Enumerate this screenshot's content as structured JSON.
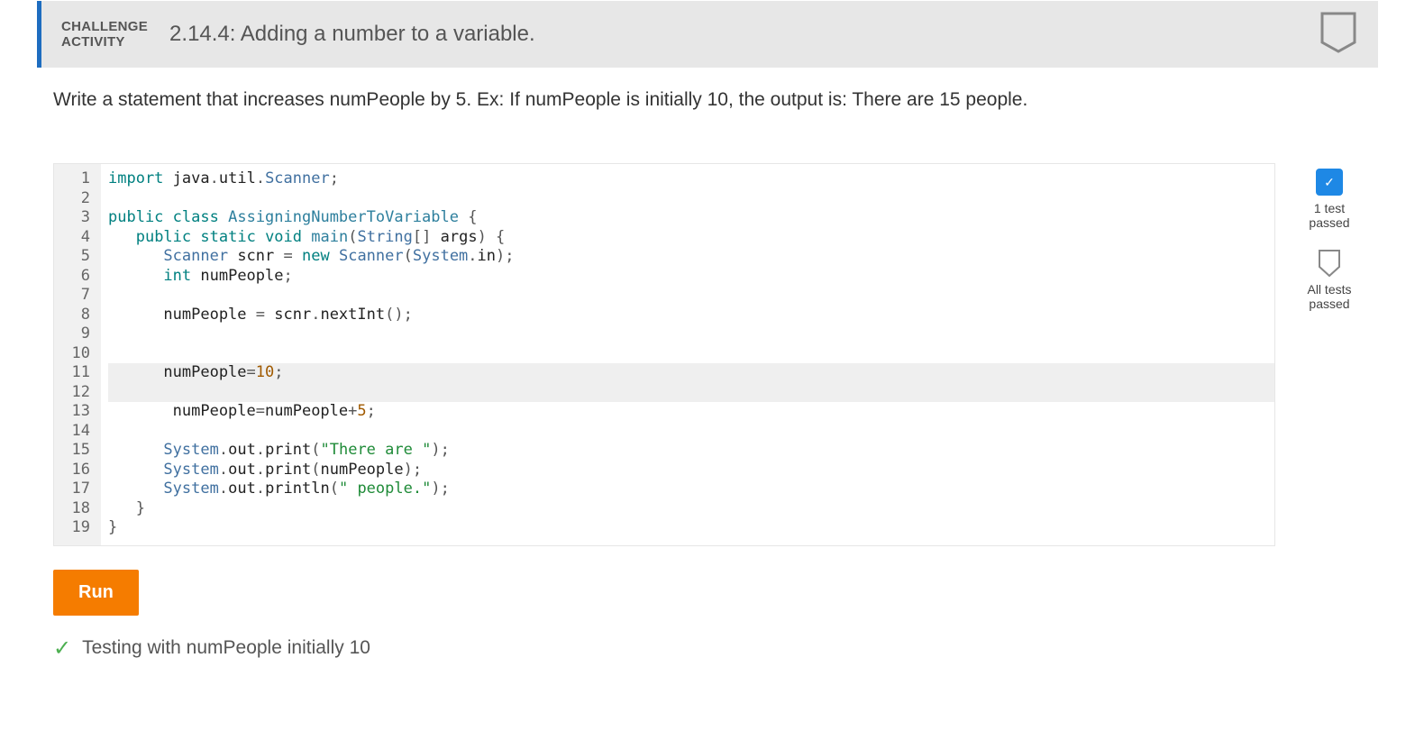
{
  "header": {
    "kicker_line1": "CHALLENGE",
    "kicker_line2": "ACTIVITY",
    "title": "2.14.4: Adding a number to a variable."
  },
  "prompt": "Write a statement that increases numPeople by 5. Ex: If numPeople is initially 10, the output is: There are 15 people.",
  "code": {
    "line_count": 19,
    "lines": [
      {
        "n": 1,
        "t": [
          [
            "kw",
            "import"
          ],
          [
            "",
            " java"
          ],
          [
            "pn",
            "."
          ],
          [
            "",
            "util"
          ],
          [
            "pn",
            "."
          ],
          [
            "ty",
            "Scanner"
          ],
          [
            "pn",
            ";"
          ]
        ]
      },
      {
        "n": 2,
        "t": [
          [
            "",
            ""
          ]
        ]
      },
      {
        "n": 3,
        "t": [
          [
            "kw",
            "public"
          ],
          [
            "",
            " "
          ],
          [
            "kw",
            "class"
          ],
          [
            "",
            " "
          ],
          [
            "nm",
            "AssigningNumberToVariable"
          ],
          [
            "",
            " "
          ],
          [
            "pn",
            "{"
          ]
        ]
      },
      {
        "n": 4,
        "t": [
          [
            "",
            "   "
          ],
          [
            "kw",
            "public"
          ],
          [
            "",
            " "
          ],
          [
            "kw",
            "static"
          ],
          [
            "",
            " "
          ],
          [
            "kw",
            "void"
          ],
          [
            "",
            " "
          ],
          [
            "nm",
            "main"
          ],
          [
            "pn",
            "("
          ],
          [
            "ty",
            "String"
          ],
          [
            "pn",
            "[]"
          ],
          [
            "",
            " args"
          ],
          [
            "pn",
            ") {"
          ]
        ]
      },
      {
        "n": 5,
        "t": [
          [
            "",
            "      "
          ],
          [
            "ty",
            "Scanner"
          ],
          [
            "",
            " scnr "
          ],
          [
            "pn",
            "="
          ],
          [
            "",
            " "
          ],
          [
            "kw",
            "new"
          ],
          [
            "",
            " "
          ],
          [
            "ty",
            "Scanner"
          ],
          [
            "pn",
            "("
          ],
          [
            "ty",
            "System"
          ],
          [
            "pn",
            "."
          ],
          [
            "",
            "in"
          ],
          [
            "pn",
            ");"
          ]
        ]
      },
      {
        "n": 6,
        "t": [
          [
            "",
            "      "
          ],
          [
            "kw",
            "int"
          ],
          [
            "",
            " numPeople"
          ],
          [
            "pn",
            ";"
          ]
        ]
      },
      {
        "n": 7,
        "t": [
          [
            "",
            ""
          ]
        ]
      },
      {
        "n": 8,
        "t": [
          [
            "",
            "      numPeople "
          ],
          [
            "pn",
            "="
          ],
          [
            "",
            " scnr"
          ],
          [
            "pn",
            "."
          ],
          [
            "",
            "nextInt"
          ],
          [
            "pn",
            "();"
          ]
        ]
      },
      {
        "n": 9,
        "t": [
          [
            "",
            ""
          ]
        ]
      },
      {
        "n": 10,
        "t": [
          [
            "",
            ""
          ]
        ]
      },
      {
        "n": 11,
        "hl": true,
        "t": [
          [
            "",
            "      numPeople"
          ],
          [
            "pn",
            "="
          ],
          [
            "nu",
            "10"
          ],
          [
            "pn",
            ";"
          ]
        ]
      },
      {
        "n": 12,
        "hl": true,
        "t": [
          [
            "",
            "      "
          ]
        ]
      },
      {
        "n": 13,
        "t": [
          [
            "",
            "       numPeople"
          ],
          [
            "pn",
            "="
          ],
          [
            "",
            "numPeople"
          ],
          [
            "pn",
            "+"
          ],
          [
            "nu",
            "5"
          ],
          [
            "pn",
            ";"
          ]
        ]
      },
      {
        "n": 14,
        "t": [
          [
            "",
            ""
          ]
        ]
      },
      {
        "n": 15,
        "t": [
          [
            "",
            "      "
          ],
          [
            "ty",
            "System"
          ],
          [
            "pn",
            "."
          ],
          [
            "",
            "out"
          ],
          [
            "pn",
            "."
          ],
          [
            "",
            "print"
          ],
          [
            "pn",
            "("
          ],
          [
            "st",
            "\"There are \""
          ],
          [
            "pn",
            ");"
          ]
        ]
      },
      {
        "n": 16,
        "t": [
          [
            "",
            "      "
          ],
          [
            "ty",
            "System"
          ],
          [
            "pn",
            "."
          ],
          [
            "",
            "out"
          ],
          [
            "pn",
            "."
          ],
          [
            "",
            "print"
          ],
          [
            "pn",
            "("
          ],
          [
            "",
            "numPeople"
          ],
          [
            "pn",
            ");"
          ]
        ]
      },
      {
        "n": 17,
        "t": [
          [
            "",
            "      "
          ],
          [
            "ty",
            "System"
          ],
          [
            "pn",
            "."
          ],
          [
            "",
            "out"
          ],
          [
            "pn",
            "."
          ],
          [
            "",
            "println"
          ],
          [
            "pn",
            "("
          ],
          [
            "st",
            "\" people.\""
          ],
          [
            "pn",
            ");"
          ]
        ]
      },
      {
        "n": 18,
        "t": [
          [
            "",
            "   "
          ],
          [
            "pn",
            "}"
          ]
        ]
      },
      {
        "n": 19,
        "t": [
          [
            "pn",
            "}"
          ]
        ]
      }
    ]
  },
  "run_label": "Run",
  "result": {
    "icon": "check",
    "text": "Testing with numPeople initially 10"
  },
  "sidebar": {
    "test1": {
      "label": "1 test\npassed",
      "state": "passed"
    },
    "test_all": {
      "label": "All tests\npassed",
      "state": "pending"
    }
  }
}
